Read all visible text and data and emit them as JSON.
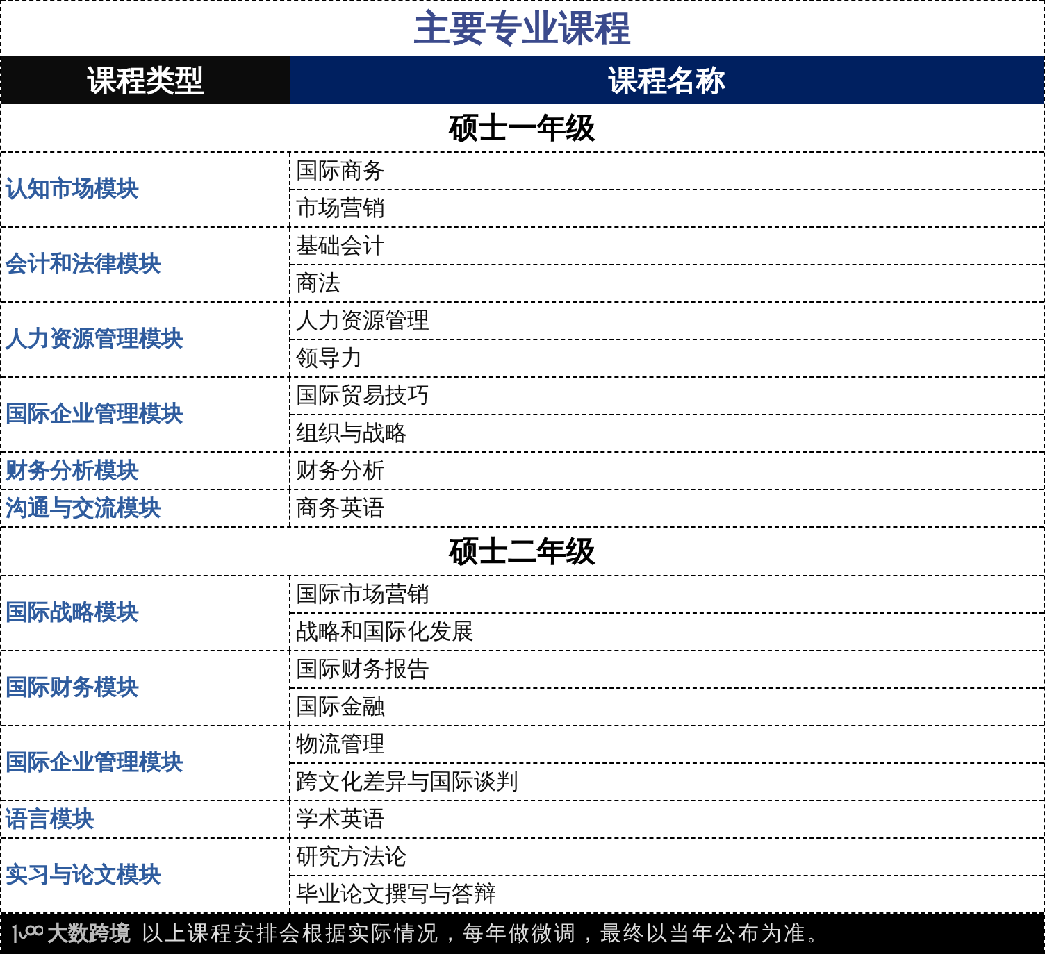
{
  "title": "主要专业课程",
  "columns": [
    {
      "label": "课程类型",
      "kind": "dark"
    },
    {
      "label": "课程名称",
      "kind": "navy"
    }
  ],
  "sections": [
    {
      "heading": "硕士一年级",
      "modules": [
        {
          "name": "认知市场模块",
          "courses": [
            "国际商务",
            "市场营销"
          ]
        },
        {
          "name": "会计和法律模块",
          "courses": [
            "基础会计",
            "商法"
          ]
        },
        {
          "name": "人力资源管理模块",
          "courses": [
            "人力资源管理",
            "领导力"
          ]
        },
        {
          "name": "国际企业管理模块",
          "courses": [
            "国际贸易技巧",
            "组织与战略"
          ]
        },
        {
          "name": "财务分析模块",
          "courses": [
            "财务分析"
          ]
        },
        {
          "name": "沟通与交流模块",
          "courses": [
            "商务英语"
          ]
        }
      ]
    },
    {
      "heading": "硕士二年级",
      "modules": [
        {
          "name": "国际战略模块",
          "courses": [
            "国际市场营销",
            "战略和国际化发展"
          ]
        },
        {
          "name": "国际财务模块",
          "courses": [
            "国际财务报告",
            "国际金融"
          ]
        },
        {
          "name": "国际企业管理模块",
          "courses": [
            "物流管理",
            "跨文化差异与国际谈判"
          ]
        },
        {
          "name": "语言模块",
          "courses": [
            "学术英语"
          ]
        },
        {
          "name": "实习与论文模块",
          "courses": [
            "研究方法论",
            "毕业论文撰写与答辩"
          ]
        }
      ]
    }
  ],
  "footer": {
    "brand": "大数跨境",
    "note": "以上课程安排会根据实际情况，每年做微调，最终以当年公布为准。"
  }
}
